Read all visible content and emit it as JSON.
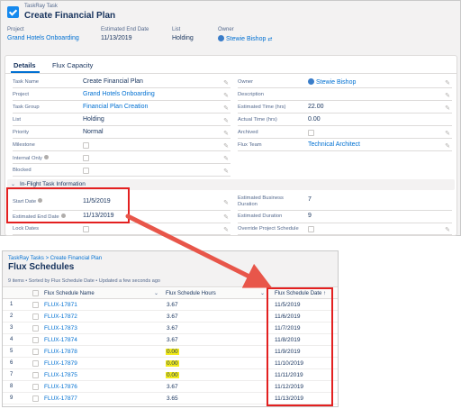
{
  "header": {
    "object_type": "TaskRay Task",
    "record_title": "Create Financial Plan"
  },
  "highlights": {
    "project_label": "Project",
    "project_value": "Grand Hotels Onboarding",
    "end_date_label": "Estimated End Date",
    "end_date_value": "11/13/2019",
    "list_label": "List",
    "list_value": "Holding",
    "owner_label": "Owner",
    "owner_value": "Stewie Bishop"
  },
  "tabs": {
    "details": "Details",
    "flux": "Flux Capacity"
  },
  "fields_left": [
    {
      "label": "Task Name",
      "value": "Create Financial Plan"
    },
    {
      "label": "Project",
      "value": "Grand Hotels Onboarding"
    },
    {
      "label": "Task Group",
      "value": "Financial Plan Creation"
    },
    {
      "label": "List",
      "value": "Holding"
    },
    {
      "label": "Priority",
      "value": "Normal"
    },
    {
      "label": "Milestone",
      "value": ""
    },
    {
      "label": "Internal Only",
      "value": ""
    },
    {
      "label": "Blocked",
      "value": ""
    }
  ],
  "fields_right": [
    {
      "label": "Owner",
      "value": "Stewie Bishop"
    },
    {
      "label": "Description",
      "value": ""
    },
    {
      "label": "Estimated Time (hrs)",
      "value": "22.00"
    },
    {
      "label": "Actual Time (hrs)",
      "value": "0.00"
    },
    {
      "label": "Archived",
      "value": ""
    },
    {
      "label": "Flux Team",
      "value": "Technical Architect"
    }
  ],
  "section": {
    "title": "In-Flight Task Information"
  },
  "inflight_left": [
    {
      "label": "Start Date",
      "value": "11/5/2019"
    },
    {
      "label": "Estimated End Date",
      "value": "11/13/2019"
    },
    {
      "label": "Lock Dates",
      "value": ""
    }
  ],
  "inflight_right": [
    {
      "label": "Estimated Business",
      "label2": "Duration",
      "value": "7"
    },
    {
      "label": "Estimated Duration",
      "value": "9"
    },
    {
      "label": "Override Project Schedule",
      "value": ""
    }
  ],
  "list": {
    "breadcrumb": "TaskRay Tasks > Create Financial Plan",
    "title": "Flux Schedules",
    "meta": "9 items • Sorted by Flux Schedule Date • Updated a few seconds ago",
    "columns": {
      "name": "Flux Schedule Name",
      "hours": "Flux Schedule Hours",
      "date": "Flux Schedule Date ↑"
    },
    "rows": [
      {
        "num": "1",
        "name": "FLUX-17871",
        "hours": "3.67",
        "date": "11/5/2019"
      },
      {
        "num": "2",
        "name": "FLUX-17872",
        "hours": "3.67",
        "date": "11/6/2019"
      },
      {
        "num": "3",
        "name": "FLUX-17873",
        "hours": "3.67",
        "date": "11/7/2019"
      },
      {
        "num": "4",
        "name": "FLUX-17874",
        "hours": "3.67",
        "date": "11/8/2019"
      },
      {
        "num": "5",
        "name": "FLUX-17878",
        "hours": "0.00",
        "date": "11/9/2019"
      },
      {
        "num": "6",
        "name": "FLUX-17879",
        "hours": "0.00",
        "date": "11/10/2019"
      },
      {
        "num": "7",
        "name": "FLUX-17875",
        "hours": "0.00",
        "date": "11/11/2019"
      },
      {
        "num": "8",
        "name": "FLUX-17876",
        "hours": "3.67",
        "date": "11/12/2019"
      },
      {
        "num": "9",
        "name": "FLUX-17877",
        "hours": "3.65",
        "date": "11/13/2019"
      }
    ]
  },
  "colors": {
    "link": "#0070d2",
    "annotation_red": "#e32020",
    "highlight_yellow": "#f2ea1a",
    "app_icon": "#1589ee"
  }
}
